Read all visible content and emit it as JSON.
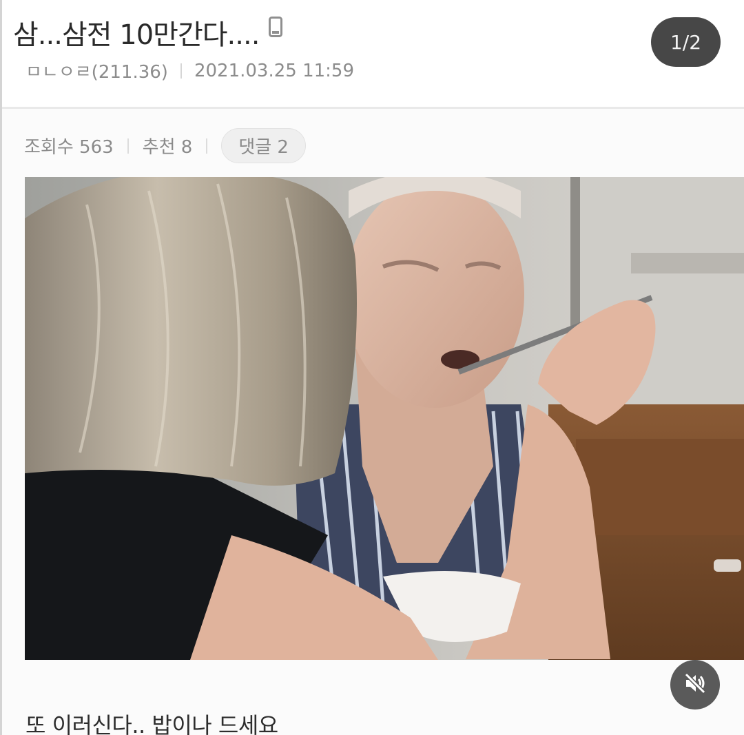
{
  "post": {
    "title": "삼...삼전 10만간다....",
    "author": "ㅁㄴㅇㄹ(211.36)",
    "datetime": "2021.03.25 11:59"
  },
  "stats": {
    "views": "조회수 563",
    "recommend": "추천 8",
    "comments": "댓글 2"
  },
  "media": {
    "page_counter": "1/2",
    "mute_icon": "speaker-muted-icon"
  },
  "caption": "또 이러신다.. 밥이나 드세요",
  "icons": {
    "device": "mobile-phone-icon"
  },
  "colors": {
    "counter_bg": "#474747",
    "text_dark": "#2a2a2a",
    "text_meta": "#8c8c8c"
  }
}
